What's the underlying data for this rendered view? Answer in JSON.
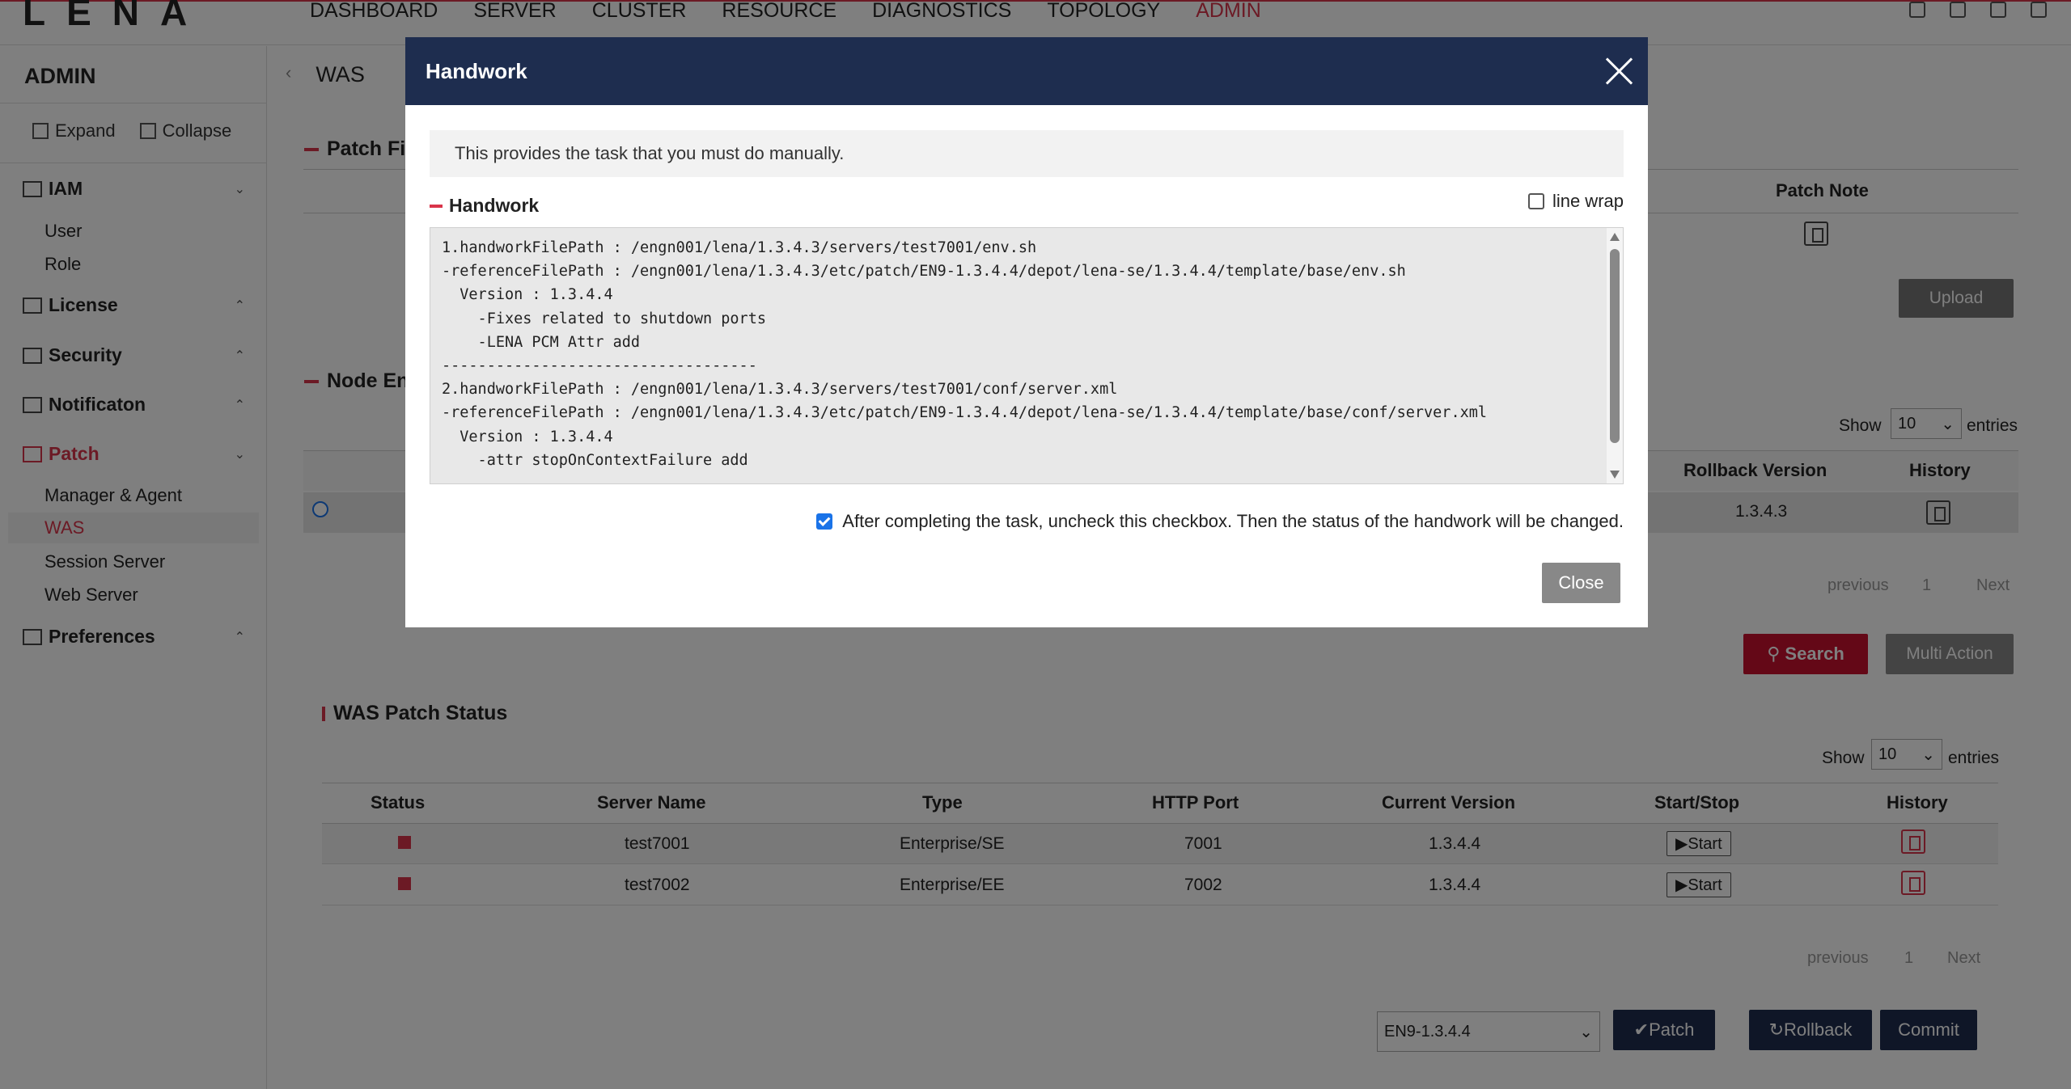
{
  "topbar": {
    "logo": "LENA",
    "nav": [
      "DASHBOARD",
      "SERVER",
      "CLUSTER",
      "RESOURCE",
      "DIAGNOSTICS",
      "TOPOLOGY",
      "ADMIN"
    ],
    "active_nav": "ADMIN"
  },
  "sidebar": {
    "title": "ADMIN",
    "expand": "Expand",
    "collapse": "Collapse",
    "groups": {
      "iam": "IAM",
      "license": "License",
      "security": "Security",
      "notification": "Notificaton",
      "patch": "Patch",
      "preferences": "Preferences"
    },
    "iam_items": [
      "User",
      "Role"
    ],
    "patch_items": [
      "Manager & Agent",
      "WAS",
      "Session Server",
      "Web Server"
    ]
  },
  "content": {
    "breadcrumb": "WAS",
    "patch_file_title": "Patch Fil",
    "patch_note_header": "Patch Note",
    "upload": "Upload",
    "node_engine_title": "Node Eng",
    "show": "Show",
    "entries": "entries",
    "page_size": "10",
    "rollback_version_header": "Rollback Version",
    "history_header": "History",
    "rollback_version_value": "1.3.4.3",
    "previous": "previous",
    "next": "Next",
    "page": "1",
    "search": "Search",
    "multi_action": "Multi Action",
    "was_patch_status_title": "WAS Patch Status",
    "status_columns": [
      "Status",
      "Server Name",
      "Type",
      "HTTP Port",
      "Current Version",
      "Start/Stop",
      "History"
    ],
    "status_rows": [
      {
        "server": "test7001",
        "type": "Enterprise/SE",
        "port": "7001",
        "version": "1.3.4.4",
        "action": "Start"
      },
      {
        "server": "test7002",
        "type": "Enterprise/EE",
        "port": "7002",
        "version": "1.3.4.4",
        "action": "Start"
      }
    ],
    "patch_version_select": "EN9-1.3.4.4",
    "patch": "Patch",
    "rollback": "Rollback",
    "commit": "Commit"
  },
  "modal": {
    "title": "Handwork",
    "info": "This provides the task that you must do manually.",
    "section_title": "Handwork",
    "line_wrap_label": "line wrap",
    "line_wrap_checked": false,
    "code_lines": [
      "1.handworkFilePath : /engn001/lena/1.3.4.3/servers/test7001/env.sh",
      "-referenceFilePath : /engn001/lena/1.3.4.3/etc/patch/EN9-1.3.4.4/depot/lena-se/1.3.4.4/template/base/env.sh",
      "  Version : 1.3.4.4",
      "    -Fixes related to shutdown ports",
      "    -LENA PCM Attr add",
      "-----------------------------------",
      "2.handworkFilePath : /engn001/lena/1.3.4.3/servers/test7001/conf/server.xml",
      "-referenceFilePath : /engn001/lena/1.3.4.3/etc/patch/EN9-1.3.4.4/depot/lena-se/1.3.4.4/template/base/conf/server.xml",
      "  Version : 1.3.4.4",
      "    -attr stopOnContextFailure add"
    ],
    "confirm_text": "After completing the task, uncheck this checkbox. Then the status of the handwork will be changed.",
    "confirm_checked": true,
    "close": "Close"
  }
}
